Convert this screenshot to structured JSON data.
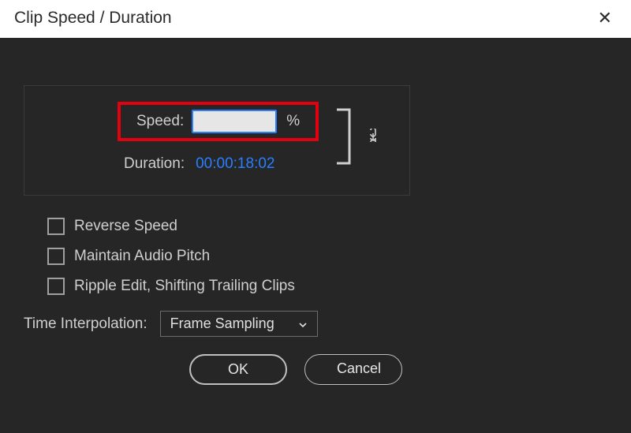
{
  "titlebar": {
    "title": "Clip Speed / Duration",
    "close": "✕"
  },
  "speed": {
    "label": "Speed:",
    "value": "",
    "unit": "%"
  },
  "duration": {
    "label": "Duration:",
    "value": "00:00:18:02"
  },
  "checkboxes": {
    "reverse": "Reverse Speed",
    "maintain": "Maintain Audio Pitch",
    "ripple": "Ripple Edit, Shifting Trailing Clips"
  },
  "interpolation": {
    "label": "Time Interpolation:",
    "selected": "Frame Sampling"
  },
  "buttons": {
    "ok": "OK",
    "cancel": "Cancel"
  }
}
